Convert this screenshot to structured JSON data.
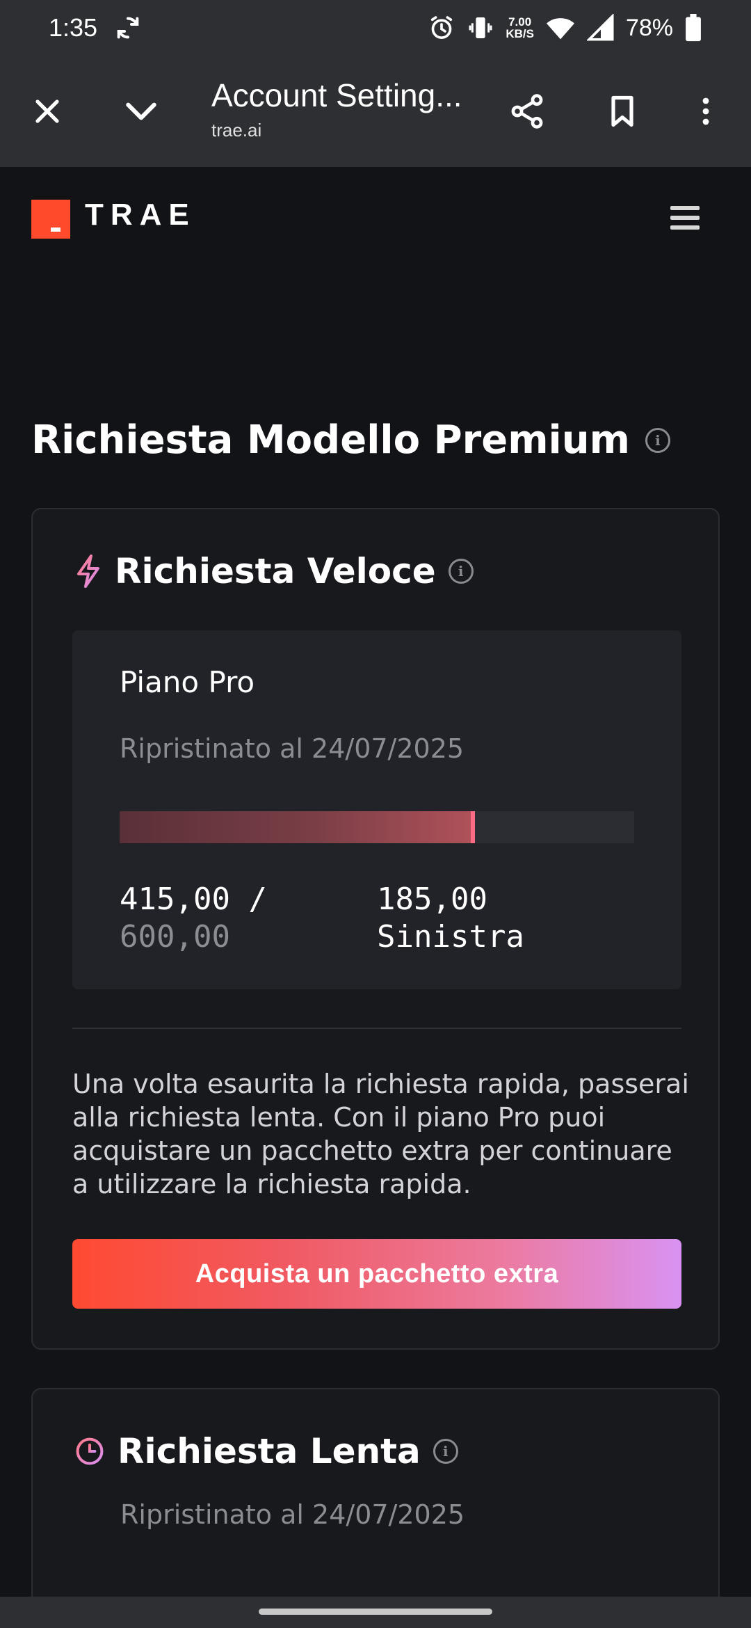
{
  "status_bar": {
    "time": "1:35",
    "net_speed_value": "7.00",
    "net_speed_unit": "KB/S",
    "battery_percent": "78%"
  },
  "browser": {
    "title": "Account Setting...",
    "url": "trae.ai"
  },
  "site": {
    "logo_text": "TRAE"
  },
  "page": {
    "title": "Richiesta Modello Premium"
  },
  "fast_request": {
    "heading": "Richiesta Veloce",
    "plan_name": "Piano Pro",
    "reset_text": "Ripristinato al 24/07/2025",
    "used": "415,00 /",
    "total": "600,00",
    "remaining": "185,00",
    "remaining_label": "Sinistra",
    "progress_fraction": 0.69,
    "description": "Una volta esaurita la richiesta rapida, passerai alla richiesta lenta. Con il piano Pro puoi acquistare un pacchetto extra per continuare a utilizzare la richiesta rapida.",
    "buy_button_label": "Acquista un pacchetto extra"
  },
  "slow_request": {
    "heading": "Richiesta Lenta",
    "reset_text": "Ripristinato al 24/07/2025"
  },
  "colors": {
    "accent": "#ff4a2c",
    "background": "#121317",
    "card": "#18191d"
  }
}
